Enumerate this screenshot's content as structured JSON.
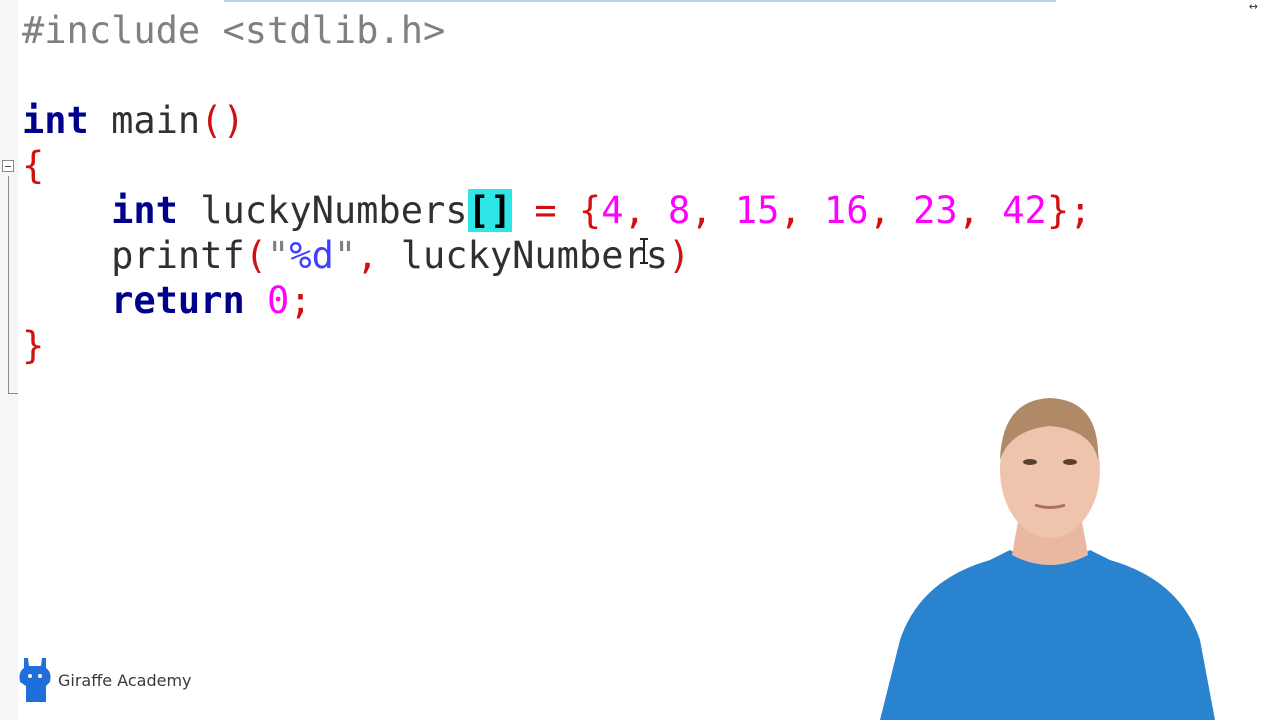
{
  "editor": {
    "code_lines": [
      [
        {
          "cls": "pp",
          "text": "#include <stdlib.h>"
        }
      ],
      [],
      [
        {
          "cls": "kw",
          "text": "int"
        },
        {
          "cls": "plain",
          "text": " main"
        },
        {
          "cls": "punc",
          "text": "()"
        }
      ],
      [
        {
          "cls": "punc",
          "text": "{"
        }
      ],
      [
        {
          "cls": "plain",
          "text": "    "
        },
        {
          "cls": "kw",
          "text": "int"
        },
        {
          "cls": "plain",
          "text": " luckyNumbers"
        },
        {
          "cls": "brk",
          "text": "[]"
        },
        {
          "cls": "plain",
          "text": " "
        },
        {
          "cls": "punc",
          "text": "= {"
        },
        {
          "cls": "num",
          "text": "4"
        },
        {
          "cls": "punc",
          "text": ", "
        },
        {
          "cls": "num",
          "text": "8"
        },
        {
          "cls": "punc",
          "text": ", "
        },
        {
          "cls": "num",
          "text": "15"
        },
        {
          "cls": "punc",
          "text": ", "
        },
        {
          "cls": "num",
          "text": "16"
        },
        {
          "cls": "punc",
          "text": ", "
        },
        {
          "cls": "num",
          "text": "23"
        },
        {
          "cls": "punc",
          "text": ", "
        },
        {
          "cls": "num",
          "text": "42"
        },
        {
          "cls": "punc",
          "text": "};"
        }
      ],
      [
        {
          "cls": "plain",
          "text": "    printf"
        },
        {
          "cls": "punc",
          "text": "("
        },
        {
          "cls": "str",
          "text": "\""
        },
        {
          "cls": "fmt",
          "text": "%d"
        },
        {
          "cls": "str",
          "text": "\""
        },
        {
          "cls": "punc",
          "text": ", "
        },
        {
          "cls": "plain",
          "text": "luckyNumbers"
        },
        {
          "cls": "punc",
          "text": ")"
        }
      ],
      [
        {
          "cls": "plain",
          "text": "    "
        },
        {
          "cls": "kw",
          "text": "return"
        },
        {
          "cls": "plain",
          "text": " "
        },
        {
          "cls": "num",
          "text": "0"
        },
        {
          "cls": "punc",
          "text": ";"
        }
      ],
      [
        {
          "cls": "punc",
          "text": "}"
        }
      ]
    ]
  },
  "corner_mark": "↔",
  "brand": {
    "name": "Giraffe Academy",
    "logo_icon": "giraffe-icon",
    "logo_color": "#1e6fd9"
  },
  "presenter": {
    "shirt_color": "#2a83cf"
  }
}
